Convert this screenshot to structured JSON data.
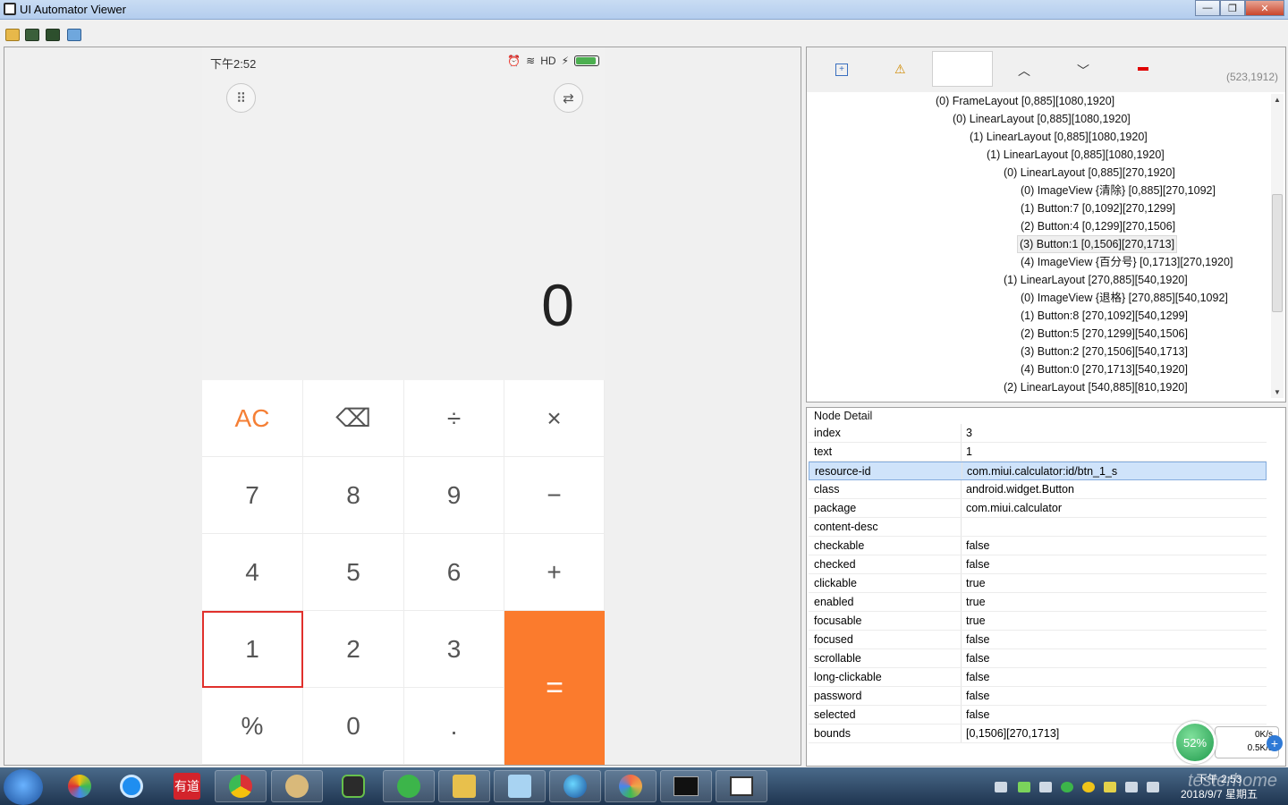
{
  "window": {
    "title": "UI Automator Viewer",
    "min": "—",
    "max": "❐",
    "close": "✕"
  },
  "phone": {
    "time": "下午2:52",
    "status_hd": "HD",
    "display_value": "0",
    "keys": {
      "ac": "AC",
      "backspace": "⌫",
      "divide": "÷",
      "multiply": "×",
      "seven": "7",
      "eight": "8",
      "nine": "9",
      "minus": "−",
      "four": "4",
      "five": "5",
      "six": "6",
      "plus": "+",
      "one": "1",
      "two": "2",
      "three": "3",
      "equals": "=",
      "percent": "%",
      "zero": "0",
      "dot": "."
    },
    "accent_color": "#fb7b2d",
    "battery_level": 0.9
  },
  "hierarchy": {
    "coord": "(523,1912)",
    "items": [
      "(0) FrameLayout [0,885][1080,1920]",
      "(0) LinearLayout [0,885][1080,1920]",
      "(1) LinearLayout [0,885][1080,1920]",
      "(1) LinearLayout [0,885][1080,1920]",
      "(0) LinearLayout [0,885][270,1920]",
      "(0) ImageView {清除} [0,885][270,1092]",
      "(1) Button:7 [0,1092][270,1299]",
      "(2) Button:4 [0,1299][270,1506]",
      "(3) Button:1 [0,1506][270,1713]",
      "(4) ImageView {百分号} [0,1713][270,1920]",
      "(1) LinearLayout [270,885][540,1920]",
      "(0) ImageView {退格} [270,885][540,1092]",
      "(1) Button:8 [270,1092][540,1299]",
      "(2) Button:5 [270,1299][540,1506]",
      "(3) Button:2 [270,1506][540,1713]",
      "(4) Button:0 [270,1713][540,1920]",
      "(2) LinearLayout [540,885][810,1920]"
    ]
  },
  "node_detail": {
    "header": "Node Detail",
    "rows": [
      {
        "k": "index",
        "v": "3"
      },
      {
        "k": "text",
        "v": "1"
      },
      {
        "k": "resource-id",
        "v": "com.miui.calculator:id/btn_1_s"
      },
      {
        "k": "class",
        "v": "android.widget.Button"
      },
      {
        "k": "package",
        "v": "com.miui.calculator"
      },
      {
        "k": "content-desc",
        "v": ""
      },
      {
        "k": "checkable",
        "v": "false"
      },
      {
        "k": "checked",
        "v": "false"
      },
      {
        "k": "clickable",
        "v": "true"
      },
      {
        "k": "enabled",
        "v": "true"
      },
      {
        "k": "focusable",
        "v": "true"
      },
      {
        "k": "focused",
        "v": "false"
      },
      {
        "k": "scrollable",
        "v": "false"
      },
      {
        "k": "long-clickable",
        "v": "false"
      },
      {
        "k": "password",
        "v": "false"
      },
      {
        "k": "selected",
        "v": "false"
      },
      {
        "k": "bounds",
        "v": "[0,1506][270,1713]"
      }
    ]
  },
  "speed": {
    "percent": "52%",
    "up": "0K/s",
    "down": "0.5K/s",
    "plus": "+"
  },
  "taskbar": {
    "youdao": "有道",
    "time": "下午 2:53",
    "date": "2018/9/7 星期五",
    "watermark": "testerhome"
  }
}
